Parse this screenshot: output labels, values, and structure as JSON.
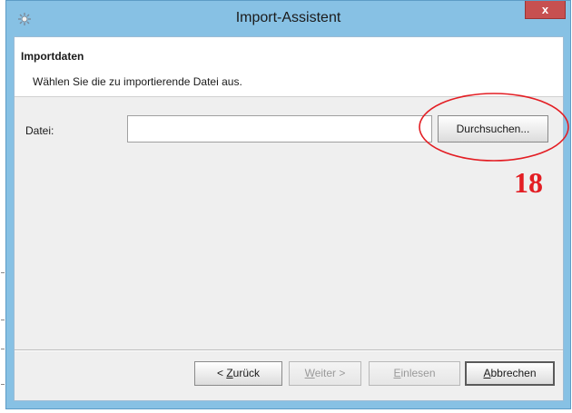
{
  "window": {
    "title": "Import-Assistent",
    "close_label": "x"
  },
  "header": {
    "title": "Importdaten",
    "description": "Wählen Sie die zu importierende Datei aus."
  },
  "form": {
    "file_label": "Datei:",
    "file_value": "",
    "browse_label": "Durchsuchen..."
  },
  "buttons": {
    "back": {
      "prefix": "< ",
      "mnemonic": "Z",
      "rest": "urück",
      "enabled": true
    },
    "next": {
      "mnemonic": "W",
      "rest": "eiter >",
      "enabled": false
    },
    "load": {
      "mnemonic": "E",
      "rest": "inlesen",
      "enabled": false
    },
    "cancel": {
      "mnemonic": "A",
      "rest": "bbrechen",
      "enabled": true,
      "default": true
    }
  },
  "annotation": {
    "number": "18",
    "color": "#e31e24"
  },
  "colors": {
    "window_frame": "#87c1e4",
    "close_button": "#c75050",
    "content_bg": "#efefef"
  }
}
